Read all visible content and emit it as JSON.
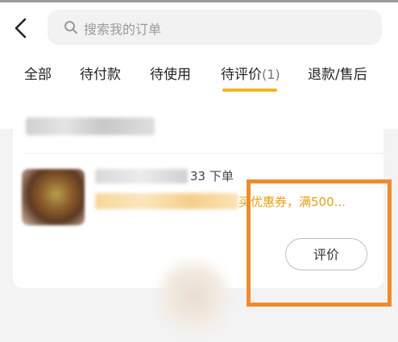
{
  "header": {
    "back_icon": "chevron-left-icon",
    "search": {
      "icon": "search-icon",
      "placeholder": "搜索我的订单"
    }
  },
  "tabs": [
    {
      "label": "全部",
      "selected": false
    },
    {
      "label": "待付款",
      "selected": false
    },
    {
      "label": "待使用",
      "selected": false
    },
    {
      "label": "待评价",
      "count": "(1)",
      "selected": true
    },
    {
      "label": "退款/售后",
      "selected": false
    }
  ],
  "colors": {
    "accent": "#f6b51d",
    "coupon_text": "#e6a014",
    "highlight_border": "#f08b2c"
  },
  "order": {
    "time_suffix": "33 下单",
    "coupon_text": "买优惠券，满500...",
    "review_button": "评价"
  }
}
